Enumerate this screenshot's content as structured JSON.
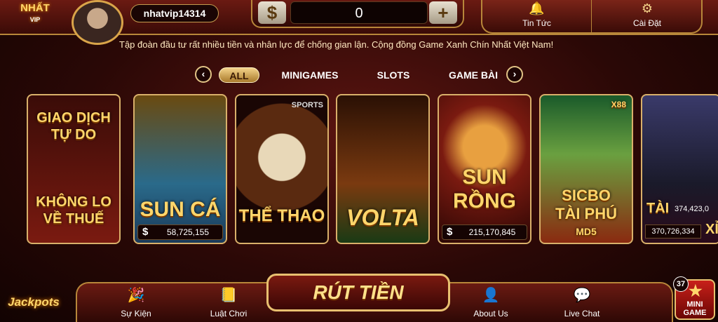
{
  "header": {
    "logo_line1": "NHẤT",
    "logo_line2": "VIP",
    "username": "nhatvip14314",
    "balance": "0",
    "dollar_symbol": "$",
    "plus_symbol": "+",
    "news_label": "Tin Tức",
    "settings_label": "Cài Đặt"
  },
  "ticker": "Tập đoàn đầu tư rất nhiều tiền và nhân lực để chống gian lận. Cộng đồng Game Xanh Chín Nhất Việt Nam!",
  "categories": {
    "prev": "‹",
    "next": "›",
    "items": [
      "ALL",
      "MINIGAMES",
      "SLOTS",
      "GAME BÀI"
    ],
    "selected": "ALL"
  },
  "cards": [
    {
      "title": "GIAO DỊCH TỰ DO",
      "subtitle": "KHÔNG LO VỀ THUẾ"
    },
    {
      "title": "SUN CÁ",
      "currency": "$",
      "jackpot": "58,725,155"
    },
    {
      "title": "THỂ THAO",
      "badge": "SPORTS"
    },
    {
      "title": "VOLTA"
    },
    {
      "title": "SUN RỒNG",
      "currency": "$",
      "jackpot": "215,170,845"
    },
    {
      "title": "SICBO TÀI PHÚ",
      "subtitle": "MD5",
      "badge": "X88"
    },
    {
      "title": "TÀI",
      "jackpot_top": "374,423,0",
      "jackpot": "370,726,334",
      "extra": "XỈ"
    }
  ],
  "jackpots_logo": "Jackpots",
  "bottom": {
    "events": "Sự Kiện",
    "rules": "Luật Chơi",
    "withdraw": "RÚT TIỀN",
    "about": "About Us",
    "chat": "Live Chat",
    "mini_badge": "37",
    "mini_label_1": "MINI",
    "mini_label_2": "GAME"
  },
  "colors": {
    "accent_gold": "#d9b06a",
    "bg_dark_red": "#2a0806"
  }
}
